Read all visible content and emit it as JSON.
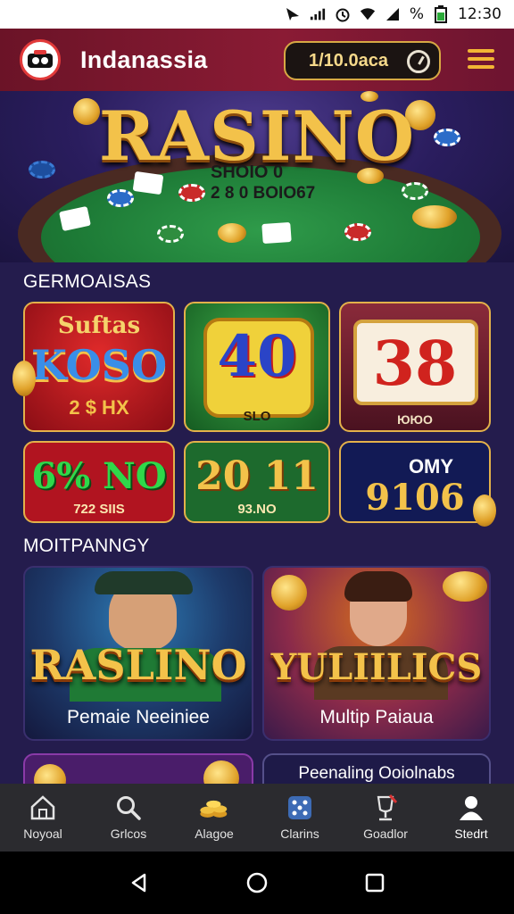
{
  "status_bar": {
    "time": "12:30",
    "battery_text": "%"
  },
  "header": {
    "app_title": "Indanassia",
    "balance": "1/10.0aca",
    "icons": [
      "logo-icon",
      "clock-icon",
      "menu-icon"
    ]
  },
  "hero": {
    "title": "RASINO",
    "subtitle_line1": "SHOIO 0",
    "subtitle_line2": "2 8 0 BOIO67"
  },
  "games_section": {
    "title": "GERMOAISAS",
    "tiles": [
      {
        "title_top": "Suftas",
        "title_main": "KOSO",
        "sub": "2 $ HX",
        "bg": "#b3131d"
      },
      {
        "title_main": "40",
        "sub": "SLO",
        "bg": "#1f7a2b"
      },
      {
        "title_main": "38",
        "sub": "ЮЮО",
        "bg": "#5a1d2a"
      },
      {
        "title_main": "6% NO",
        "sub": "722 SIIS",
        "bg": "#b11420"
      },
      {
        "title_main": "20 11",
        "sub": "93.NO",
        "bg": "#1d6a2d"
      },
      {
        "title_top": "OMY",
        "title_main": "9106",
        "bg": "#121a55"
      }
    ]
  },
  "multiplayer_section": {
    "title": "MOITPANNGY",
    "cards": [
      {
        "title": "RASLINO",
        "caption": "Pemaie Neeiniee"
      },
      {
        "title": "YULIILICS",
        "caption": "Multip Paiaua"
      }
    ],
    "partial_card_text": "Peenaling Ooiolnabs"
  },
  "bottom_nav": {
    "items": [
      {
        "label": "Noyoal",
        "icon": "home-icon"
      },
      {
        "label": "Grlcos",
        "icon": "search-icon"
      },
      {
        "label": "Alagoe",
        "icon": "coins-icon"
      },
      {
        "label": "Clarins",
        "icon": "dice-icon"
      },
      {
        "label": "Goadlor",
        "icon": "trophy-icon"
      },
      {
        "label": "Stedrt",
        "icon": "profile-icon"
      }
    ]
  },
  "colors": {
    "accent_gold": "#f3c24a",
    "header_red": "#8a1b34",
    "content_bg": "#241c4d"
  }
}
